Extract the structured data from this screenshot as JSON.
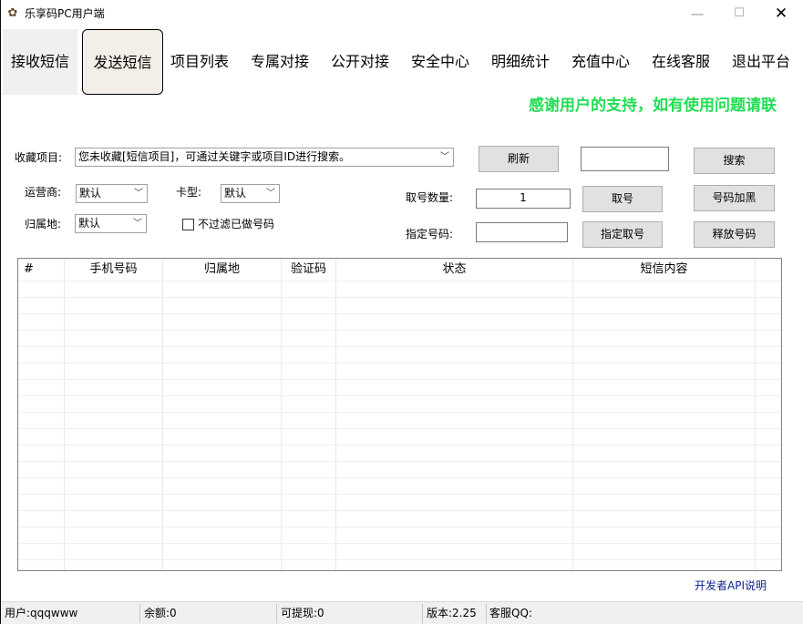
{
  "window": {
    "title": "乐享码PC用户端",
    "minimize": "—",
    "maximize": "☐",
    "close": "✕",
    "app_icon": "app-logo-icon"
  },
  "nav": {
    "tabs": [
      {
        "label": "接收短信"
      },
      {
        "label": "发送短信"
      },
      {
        "label": "项目列表"
      },
      {
        "label": "专属对接"
      },
      {
        "label": "公开对接"
      },
      {
        "label": "安全中心"
      },
      {
        "label": "明细统计"
      },
      {
        "label": "充值中心"
      },
      {
        "label": "在线客服"
      },
      {
        "label": "退出平台"
      }
    ]
  },
  "marquee": "感谢用户的支持，如有使用问题请联",
  "form": {
    "fav_label": "收藏项目:",
    "fav_value": "您未收藏[短信项目]，可通过关键字或项目ID进行搜索。",
    "refresh": "刷新",
    "search_value": "",
    "search": "搜索",
    "carrier_label": "运营商:",
    "carrier_value": "默认",
    "cardtype_label": "卡型:",
    "cardtype_value": "默认",
    "qty_label": "取号数量:",
    "qty_value": "1",
    "take": "取号",
    "blacklist": "号码加黑",
    "region_label": "归属地:",
    "region_value": "默认",
    "no_filter_label": "不过滤已做号码",
    "assign_label": "指定号码:",
    "assign_value": "",
    "assign_take": "指定取号",
    "release": "释放号码"
  },
  "table": {
    "headers": [
      "#",
      "手机号码",
      "归属地",
      "验证码",
      "状态",
      "短信内容"
    ]
  },
  "footer": {
    "api_link": "开发者API说明",
    "user": "用户:qqqwww",
    "balance": "余额:0",
    "withdrawable": "可提现:0",
    "version": "版本:2.25",
    "support": "客服QQ:"
  },
  "colors": {
    "marquee": "#22dd55",
    "link": "#0b1e8f"
  }
}
